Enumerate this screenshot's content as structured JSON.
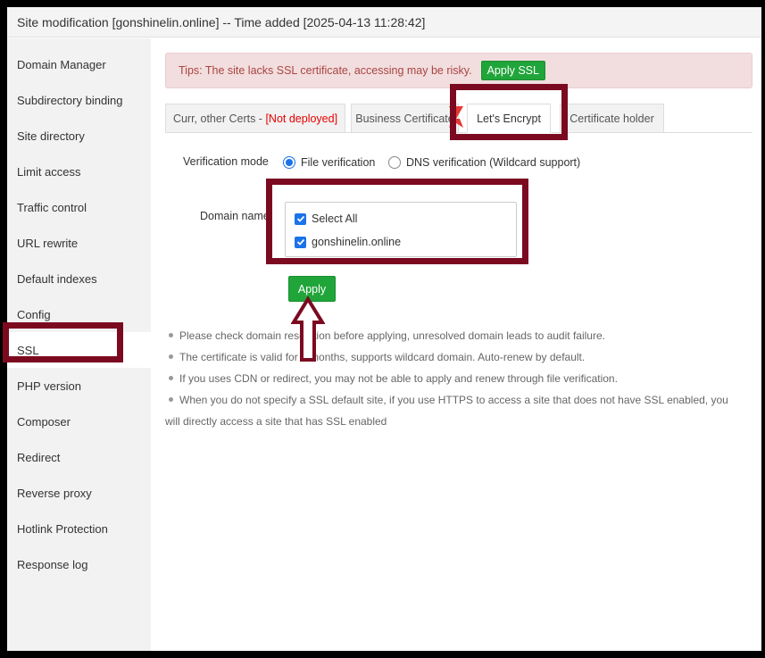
{
  "window": {
    "title": "Site modification [gonshinelin.online] -- Time added [2025-04-13 11:28:42]"
  },
  "sidebar": {
    "items": [
      {
        "label": "Domain Manager"
      },
      {
        "label": "Subdirectory binding"
      },
      {
        "label": "Site directory"
      },
      {
        "label": "Limit access"
      },
      {
        "label": "Traffic control"
      },
      {
        "label": "URL rewrite"
      },
      {
        "label": "Default indexes"
      },
      {
        "label": "Config"
      },
      {
        "label": "SSL"
      },
      {
        "label": "PHP version"
      },
      {
        "label": "Composer"
      },
      {
        "label": "Redirect"
      },
      {
        "label": "Reverse proxy"
      },
      {
        "label": "Hotlink Protection"
      },
      {
        "label": "Response log"
      }
    ],
    "active": "SSL"
  },
  "tips": {
    "text": "Tips: The site lacks SSL certificate, accessing may be risky.",
    "button": "Apply SSL"
  },
  "tabs": [
    {
      "label": "Curr, other Certs - ",
      "status": "[Not deployed]"
    },
    {
      "label": "Business Certificate"
    },
    {
      "label": "Let's Encrypt"
    },
    {
      "label": "Certificate holder"
    }
  ],
  "form": {
    "verification_label": "Verification mode",
    "radio_file": "File verification",
    "radio_dns": "DNS verification (Wildcard support)",
    "domain_label": "Domain name",
    "select_all": "Select All",
    "domain": "gonshinelin.online",
    "apply": "Apply"
  },
  "notes": [
    "Please check domain resolution before applying, unresolved domain leads to audit failure.",
    "The certificate is valid for 3 months, supports wildcard domain. Auto-renew by default.",
    "If you uses CDN or redirect, you may not be able to apply and renew through file verification.",
    "When you do not specify a SSL default site, if you use HTTPS to access a site that does not have SSL enabled, you will directly access a site that has SSL enabled"
  ],
  "colors": {
    "highlight": "#7b0a20",
    "green": "#20a53a",
    "blue": "#1a73e8"
  }
}
